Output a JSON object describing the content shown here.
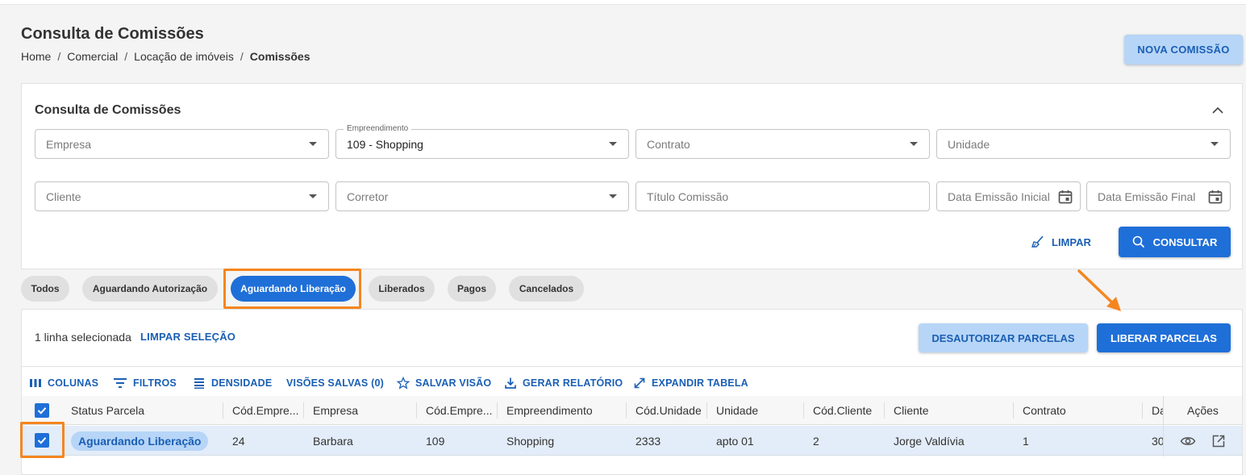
{
  "header": {
    "title": "Consulta de Comissões",
    "breadcrumb": [
      "Home",
      "Comercial",
      "Locação de imóveis",
      "Comissões"
    ],
    "breadcrumb_sep": "/",
    "new_button": "NOVA COMISSÃO"
  },
  "filters": {
    "title": "Consulta de Comissões",
    "empresa_placeholder": "Empresa",
    "empreendimento_label": "Empreendimento",
    "empreendimento_value": "109 - Shopping",
    "contrato_placeholder": "Contrato",
    "unidade_placeholder": "Unidade",
    "cliente_placeholder": "Cliente",
    "corretor_placeholder": "Corretor",
    "titulo_placeholder": "Título Comissão",
    "data_inicial_placeholder": "Data Emissão Inicial",
    "data_final_placeholder": "Data Emissão Final",
    "clear_button": "LIMPAR",
    "search_button": "CONSULTAR"
  },
  "status_tabs": [
    {
      "label": "Todos",
      "active": false
    },
    {
      "label": "Aguardando Autorização",
      "active": false
    },
    {
      "label": "Aguardando Liberação",
      "active": true
    },
    {
      "label": "Liberados",
      "active": false
    },
    {
      "label": "Pagos",
      "active": false
    },
    {
      "label": "Cancelados",
      "active": false
    }
  ],
  "selection": {
    "text": "1 linha selecionada",
    "clear_label": "LIMPAR SELEÇÃO",
    "deauthorize_button": "DESAUTORIZAR PARCELAS",
    "release_button": "LIBERAR PARCELAS"
  },
  "toolbar": {
    "columns": "COLUNAS",
    "filters": "FILTROS",
    "density": "DENSIDADE",
    "saved_views": "VISÕES SALVAS (0)",
    "save_view": "SALVAR VISÃO",
    "report": "GERAR RELATÓRIO",
    "expand": "EXPANDIR TABELA"
  },
  "table": {
    "columns": [
      "Status Parcela",
      "Cód.Empre...",
      "Empresa",
      "Cód.Empre...",
      "Empreendimento",
      "Cód.Unidade",
      "Unidade",
      "Cód.Cliente",
      "Cliente",
      "Contrato",
      "Da"
    ],
    "actions_header": "Ações",
    "rows": [
      {
        "selected": true,
        "status": "Aguardando Liberação",
        "cod_empresa": "24",
        "empresa": "Barbara",
        "cod_empreendimento": "109",
        "empreendimento": "Shopping",
        "cod_unidade": "2333",
        "unidade": "apto 01",
        "cod_cliente": "2",
        "cliente": "Jorge Valdívia",
        "contrato": "1",
        "data": "30"
      }
    ]
  },
  "colors": {
    "primary": "#1f6fd8",
    "primary_light": "#b7d5f7",
    "highlight": "#f5861f",
    "row_selected": "#e3edf9"
  }
}
